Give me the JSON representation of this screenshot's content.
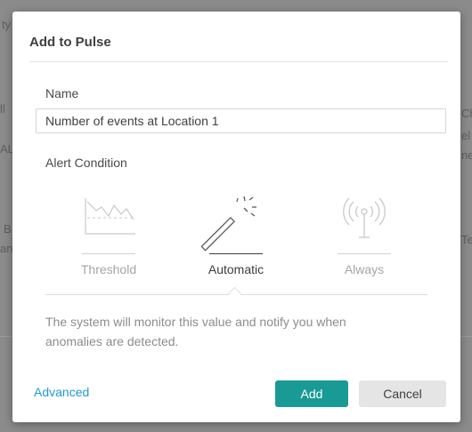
{
  "dialog": {
    "title": "Add to Pulse",
    "name_label": "Name",
    "name_value": "Number of events at Location 1",
    "alert_label": "Alert Condition",
    "options": [
      {
        "label": "Threshold",
        "icon": "threshold-chart-icon",
        "selected": false
      },
      {
        "label": "Automatic",
        "icon": "magic-wand-icon",
        "selected": true
      },
      {
        "label": "Always",
        "icon": "antenna-broadcast-icon",
        "selected": false
      }
    ],
    "description": "The system will monitor this value and notify you when anomalies are detected.",
    "advanced_link": "Advanced",
    "add_button": "Add",
    "cancel_button": "Cancel"
  },
  "background_fragments": [
    "ty",
    "ll",
    "AL",
    "B",
    "an",
    "Ch",
    "el",
    "ne",
    "Te"
  ],
  "colors": {
    "accent": "#1a9a95",
    "link": "#1e9ad6",
    "overlay": "#8b8b8b"
  }
}
